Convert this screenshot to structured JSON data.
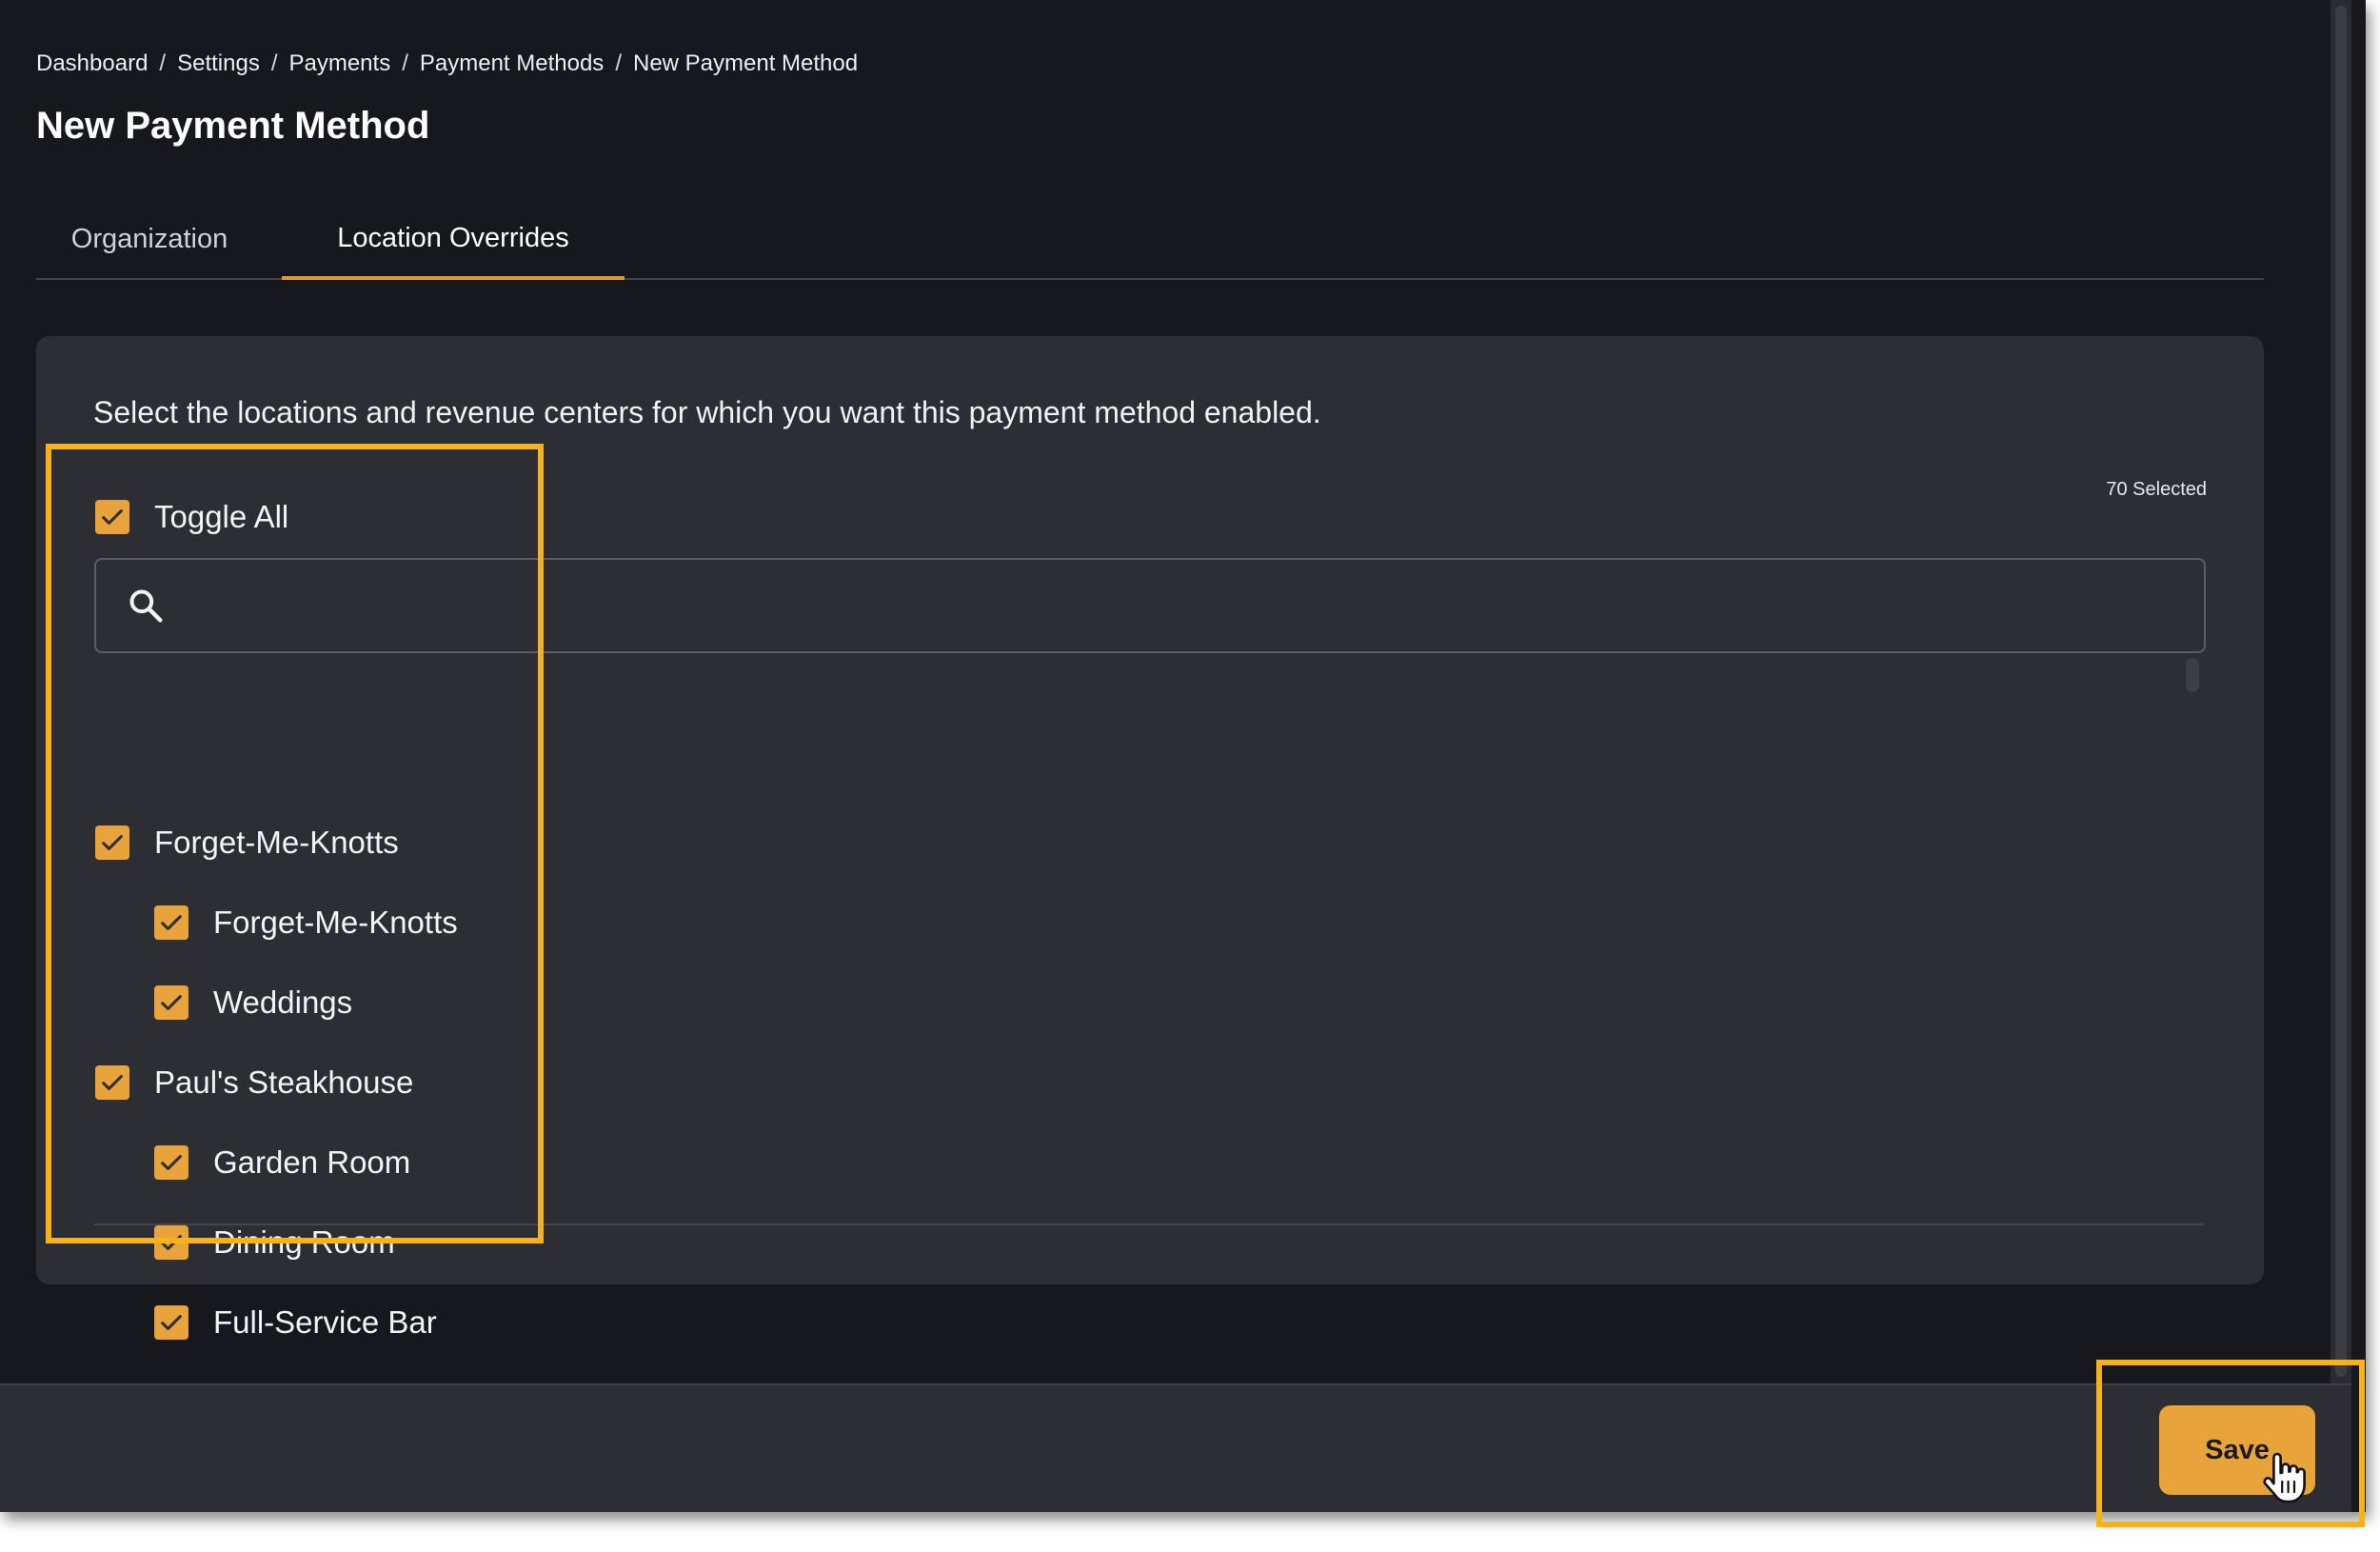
{
  "breadcrumb": [
    "Dashboard",
    "Settings",
    "Payments",
    "Payment Methods",
    "New Payment Method"
  ],
  "breadcrumb_separator": "/",
  "page_title": "New Payment Method",
  "tabs": [
    {
      "label": "Organization",
      "active": false
    },
    {
      "label": "Location Overrides",
      "active": true
    }
  ],
  "panel": {
    "instructions": "Select the locations and revenue centers for which you want this payment method enabled.",
    "selected_count": "70 Selected",
    "toggle_all_label": "Toggle All",
    "search": {
      "value": "",
      "placeholder": "",
      "icon": "search-icon"
    },
    "locations": [
      {
        "label": "Forget-Me-Knotts",
        "checked": true,
        "level": 0
      },
      {
        "label": "Forget-Me-Knotts",
        "checked": true,
        "level": 1
      },
      {
        "label": "Weddings",
        "checked": true,
        "level": 1
      },
      {
        "label": "Paul's Steakhouse",
        "checked": true,
        "level": 0
      },
      {
        "label": "Garden Room",
        "checked": true,
        "level": 1
      },
      {
        "label": "Dining Room",
        "checked": true,
        "level": 1
      },
      {
        "label": "Full-Service Bar",
        "checked": true,
        "level": 1
      }
    ]
  },
  "footer": {
    "save_label": "Save"
  },
  "colors": {
    "accent": "#e8a43a",
    "highlight": "#f5b21a",
    "background": "#16181d",
    "panel": "#2c2e33"
  }
}
